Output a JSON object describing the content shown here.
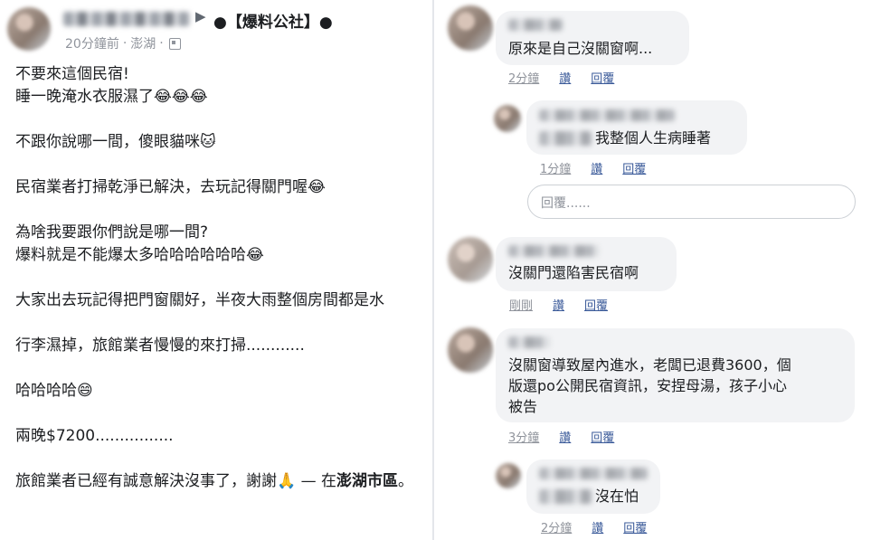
{
  "post": {
    "page_name": "●【爆料公社】●",
    "time": "20分鐘前",
    "location": "澎湖",
    "paragraphs": [
      "不要來這個民宿!\n睡一晚淹水衣服濕了😂😂😂",
      "不跟你說哪一間，傻眼貓咪🐱",
      "民宿業者打掃乾淨已解決，去玩記得關門喔😂",
      "為啥我要跟你們說是哪一間?\n爆料就是不能爆太多哈哈哈哈哈哈😂",
      "大家出去玩記得把門窗關好，半夜大雨整個房間都是水",
      "行李濕掉，旅館業者慢慢的來打掃............",
      "哈哈哈哈😄",
      "兩晚$7200................"
    ],
    "last_paragraph_prefix": "旅館業者已經有誠意解決沒事了，謝謝🙏 — 在",
    "last_paragraph_place": "澎湖市區",
    "last_paragraph_suffix": "。"
  },
  "comments": [
    {
      "text": "原來是自己沒關窗啊...",
      "time": "2分鐘",
      "like": "讚",
      "reply": "回覆"
    },
    {
      "text": "我整個人生病睡著",
      "time": "1分鐘",
      "like": "讚",
      "reply": "回覆"
    },
    {
      "text": "沒關門還陷害民宿啊",
      "time": "剛剛",
      "like": "讚",
      "reply": "回覆"
    },
    {
      "text_lines": [
        "沒關窗導致屋內進水，老闆已退費3600，個",
        "版還po公開民宿資訊，安捏母湯，孩子小心",
        "被告"
      ],
      "time": "3分鐘",
      "like": "讚",
      "reply": "回覆"
    },
    {
      "text": "沒在怕",
      "time": "2分鐘",
      "like": "讚",
      "reply": "回覆"
    }
  ],
  "reply_placeholder": "回覆......"
}
